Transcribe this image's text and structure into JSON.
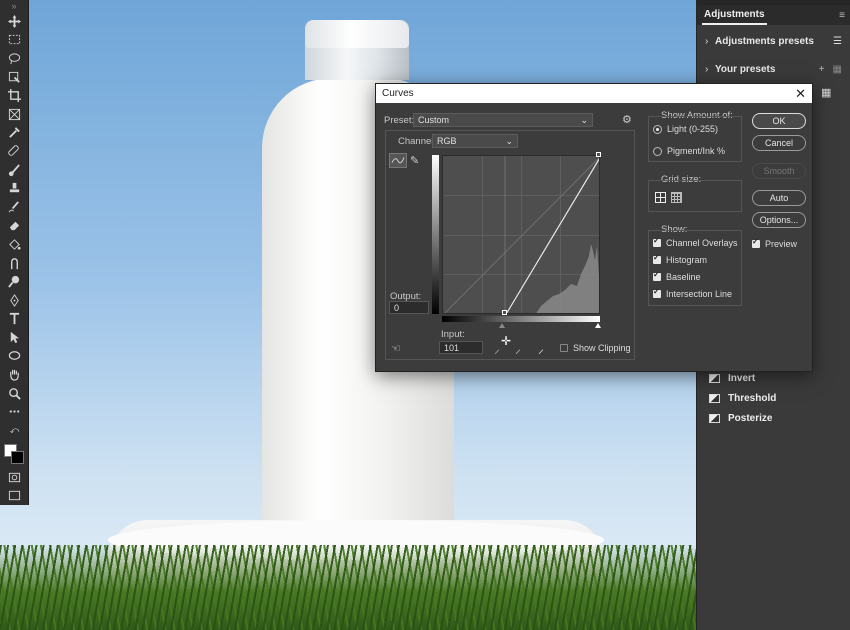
{
  "panel": {
    "tab_title": "Adjustments",
    "menu_icon": "hamburger-icon",
    "rows": [
      {
        "label": "Adjustments presets",
        "icon": "list-icon"
      },
      {
        "label": "Your presets",
        "icon": "grid-icon"
      }
    ],
    "items": [
      {
        "label": "Invert",
        "icon": "invert-icon"
      },
      {
        "label": "Threshold",
        "icon": "threshold-icon"
      },
      {
        "label": "Posterize",
        "icon": "posterize-icon"
      }
    ]
  },
  "dialog": {
    "title": "Curves",
    "preset_label": "Preset:",
    "preset_value": "Custom",
    "channel_label": "Channel:",
    "channel_value": "RGB",
    "output_label": "Output:",
    "output_value": "0",
    "input_label": "Input:",
    "input_value": "101",
    "show_clipping_label": "Show Clipping",
    "show_clipping": false,
    "show_amount_label": "Show Amount of:",
    "light_label": "Light  (0-255)",
    "pigment_label": "Pigment/Ink %",
    "light_selected": true,
    "grid_size_label": "Grid size:",
    "show_label": "Show:",
    "show_options": [
      {
        "label": "Channel Overlays",
        "checked": true
      },
      {
        "label": "Histogram",
        "checked": true
      },
      {
        "label": "Baseline",
        "checked": true
      },
      {
        "label": "Intersection Line",
        "checked": true
      }
    ],
    "buttons": {
      "ok": "OK",
      "cancel": "Cancel",
      "smooth": "Smooth",
      "auto": "Auto",
      "options": "Options..."
    },
    "preview_label": "Preview",
    "preview_checked": true,
    "curve_points": [
      [
        101,
        0
      ],
      [
        255,
        255
      ]
    ]
  }
}
